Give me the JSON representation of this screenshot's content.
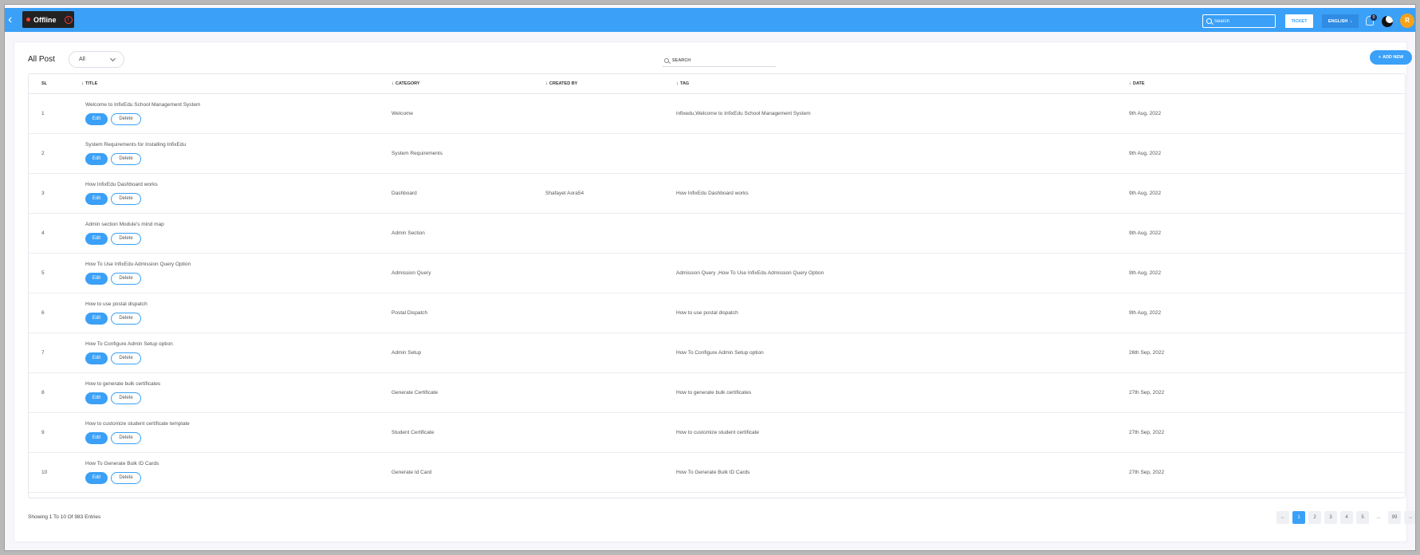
{
  "topbar": {
    "status_label": "Offline",
    "search_placeholder": "Search",
    "ticket_label": "TICKET",
    "language_label": "ENGLISH",
    "notification_count": "0",
    "avatar_initials": "R",
    "colors": {
      "bar": "#3aa0f8",
      "offline_dot": "#ff3b30",
      "avatar": "#f7a21b"
    }
  },
  "page": {
    "title": "All Post",
    "filter_value": "All",
    "search_placeholder": "SEARCH",
    "add_new_label": "ADD NEW"
  },
  "table": {
    "headers": {
      "sl": "SL",
      "title": "TITLE",
      "category": "CATEGORY",
      "created_by": "CREATED BY",
      "tag": "TAG",
      "date": "DATE"
    },
    "edit_label": "Edit",
    "delete_label": "Delete",
    "rows": [
      {
        "sl": "1",
        "title": "Welcome to InfixEdu School Management System",
        "category": "Welcome",
        "created_by": "",
        "tag": "infixedu,Welcome to InfixEdu School Management System",
        "date": "9th Aug, 2022"
      },
      {
        "sl": "2",
        "title": "System Requirements for Installing InfixEdu",
        "category": "System Requirements",
        "created_by": "",
        "tag": "",
        "date": "9th Aug, 2022"
      },
      {
        "sl": "3",
        "title": "How InfixEdu Dashboard works",
        "category": "Dashboard",
        "created_by": "Shafayet Aora54",
        "tag": "How InfixEdu Dashboard works",
        "date": "9th Aug, 2022"
      },
      {
        "sl": "4",
        "title": "Admin section Module's mind map",
        "category": "Admin Section",
        "created_by": "",
        "tag": "",
        "date": "9th Aug, 2022"
      },
      {
        "sl": "5",
        "title": "How To Use InfixEdu Admission Query Option",
        "category": "Admission Query",
        "created_by": "",
        "tag": "Admission Query ,How To Use InfixEdu Admission Query Option",
        "date": "9th Aug, 2022"
      },
      {
        "sl": "6",
        "title": "How to use postal dispatch",
        "category": "Postal Dispatch",
        "created_by": "",
        "tag": "How to use postal dispatch",
        "date": "9th Aug, 2022"
      },
      {
        "sl": "7",
        "title": "How To Configure Admin Setup option",
        "category": "Admin Setup",
        "created_by": "",
        "tag": "How To Configure Admin Setup option",
        "date": "26th Sep, 2022"
      },
      {
        "sl": "8",
        "title": "How to generate bulk certificates",
        "category": "Generate Certificate",
        "created_by": "",
        "tag": "How to generate bulk certificates",
        "date": "27th Sep, 2022"
      },
      {
        "sl": "9",
        "title": "How to customize student certificate template",
        "category": "Student Certificate",
        "created_by": "",
        "tag": "How to customize student certificate",
        "date": "27th Sep, 2022"
      },
      {
        "sl": "10",
        "title": "How To Generate Bulk ID Cards",
        "category": "Generate Id Card",
        "created_by": "",
        "tag": "How To Generate Bulk ID Cards",
        "date": "27th Sep, 2022"
      }
    ]
  },
  "footer": {
    "showing_text": "Showing 1 To 10 Of 983 Entries",
    "pages": [
      "←",
      "1",
      "2",
      "3",
      "4",
      "5",
      "...",
      "99",
      "→"
    ],
    "active_page": "1"
  }
}
